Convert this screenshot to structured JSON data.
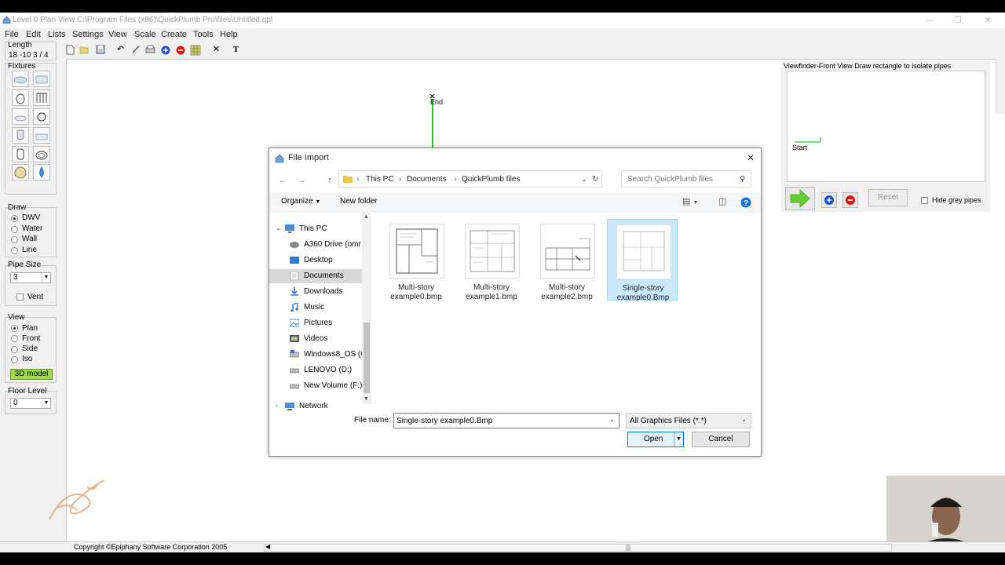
{
  "window": {
    "title": "Level 0 Plan View  C:\\Program Files (x86)\\QuickPlumb Pro\\files\\Untitled.qpl"
  },
  "menu": [
    "File",
    "Edit",
    "Lists",
    "Settings",
    "View",
    "Scale",
    "Create",
    "Tools",
    "Help"
  ],
  "length": {
    "label": "Length",
    "value": "18  -10  3 / 4"
  },
  "fixtures": {
    "label": "Fixtures"
  },
  "draw": {
    "label": "Draw",
    "options": [
      "DWV",
      "Water",
      "Wall",
      "Line"
    ],
    "selected": "DWV"
  },
  "pipe_size": {
    "label": "Pipe Size",
    "value": "3",
    "vent_label": "Vent"
  },
  "view": {
    "label": "View",
    "options": [
      "Plan",
      "Front",
      "Side",
      "Iso"
    ],
    "selected": "Plan",
    "model_button": "3D model"
  },
  "floor_level": {
    "label": "Floor Level",
    "value": "0"
  },
  "canvas": {
    "end_label": "End"
  },
  "viewfinder": {
    "title": "Viewfinder-Front View  Draw rectangle to isolate pipes",
    "start_label": "Start",
    "reset_label": "Reset",
    "hide_grey_label": "Hide grey pipes"
  },
  "status": {
    "copyright": "Copyright ©Epiphany Software Corporation 2005"
  },
  "dialog": {
    "title": "File Import",
    "breadcrumb": [
      "This PC",
      "Documents",
      "QuickPlumb files"
    ],
    "search_placeholder": "Search QuickPlumb files",
    "organize": "Organize",
    "new_folder": "New folder",
    "nav_items": [
      "This PC",
      "A360 Drive (omr",
      "Desktop",
      "Documents",
      "Downloads",
      "Music",
      "Pictures",
      "Videos",
      "Windows8_OS (C",
      "LENOVO (D:)",
      "New Volume (F:)",
      "Network"
    ],
    "selected_nav": "Documents",
    "files": [
      {
        "line1": "Multi-story",
        "line2": "example0.bmp"
      },
      {
        "line1": "Multi-story",
        "line2": "example1.bmp"
      },
      {
        "line1": "Multi-story",
        "line2": "example2.bmp"
      },
      {
        "line1": "Single-story",
        "line2": "example0.Bmp"
      }
    ],
    "selected_file_index": 3,
    "file_name_label": "File name:",
    "file_name_value": "Single-story example0.Bmp",
    "file_type": "All Graphics Files (*.*)",
    "open_label": "Open",
    "cancel_label": "Cancel"
  },
  "colors": {
    "accent_blue": "#0066cc",
    "selection": "#cce8ff",
    "green_pipe": "#22cc22",
    "start_arrow": "#66cc33"
  }
}
